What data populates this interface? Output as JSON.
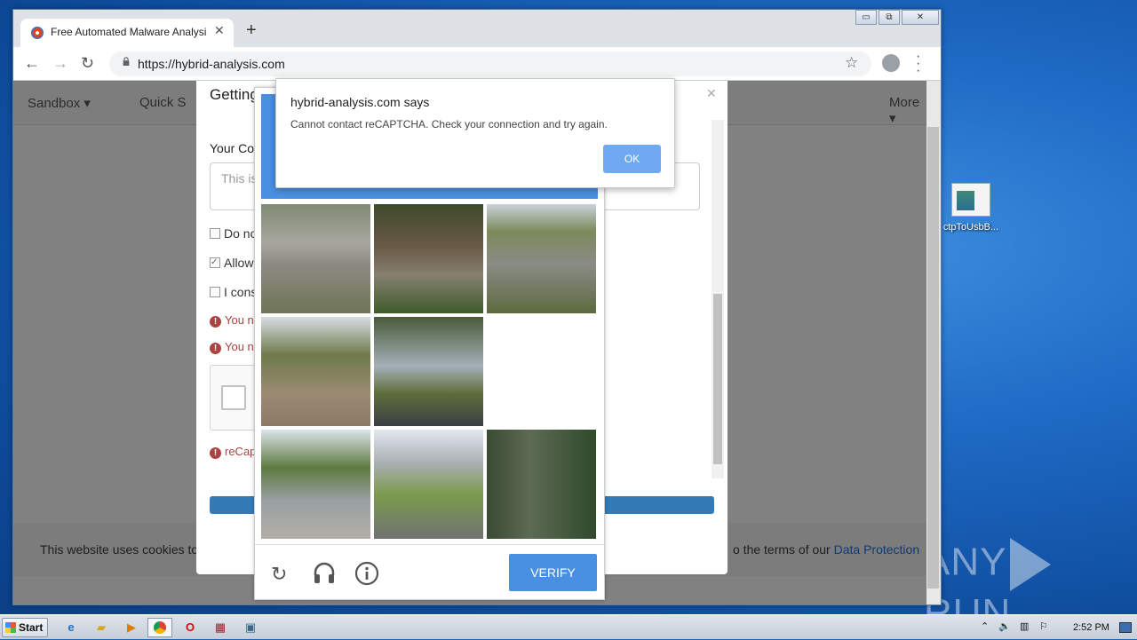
{
  "browser": {
    "tab_title": "Free Automated Malware Analysis S",
    "url": "https://hybrid-analysis.com",
    "min_label": "▭",
    "restore_label": "⧉",
    "close_label": "✕"
  },
  "site_nav": {
    "sandbox": "Sandbox ▾",
    "quick": "Quick S",
    "more": "More ▾"
  },
  "modal": {
    "title": "Getting",
    "comment_label": "Your Cor",
    "comment_placeholder": "This is",
    "checkbox1": "Do no",
    "checkbox2": "Allow",
    "checkbox3": "I cons",
    "error1": "You n",
    "error2": "You n",
    "error3": "reCap"
  },
  "cookie_bar": {
    "left_text": "This website uses cookies to",
    "right_text": "o the terms of our ",
    "link_text": "Data Protection"
  },
  "recaptcha": {
    "verify_label": "VERIFY",
    "icons": [
      "reload-icon",
      "headphones-icon",
      "info-icon"
    ]
  },
  "alert": {
    "title": "hybrid-analysis.com says",
    "message": "Cannot contact reCAPTCHA. Check your connection and try again.",
    "ok_label": "OK"
  },
  "desktop": {
    "icon_label": "ctpToUsbB...",
    "watermark_left": "ANY",
    "watermark_right": "RUN"
  },
  "taskbar": {
    "start_label": "Start",
    "clock": "2:52 PM"
  }
}
